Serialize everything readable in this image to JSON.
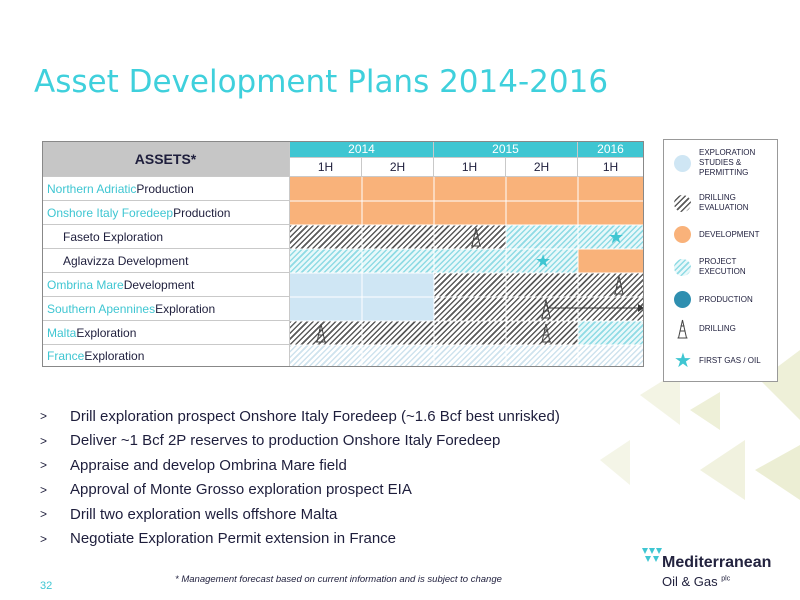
{
  "title": "Asset Development Plans 2014-2016",
  "colors": {
    "accent": "#3fc6d2",
    "development": "#f9b27a",
    "exploration_studies": "#cfe6f4",
    "production": "#2f8fb0",
    "header_gray": "#c6c6c6"
  },
  "table": {
    "assets_header": "ASSETS*",
    "years": [
      "2014",
      "2015",
      "2016"
    ],
    "halves": [
      "1H",
      "2H",
      "1H",
      "2H",
      "1H"
    ],
    "rows": [
      {
        "highlight": "Northern Adriatic",
        "rest": " Production",
        "sub": false
      },
      {
        "highlight": "Onshore Italy Foredeep",
        "rest": " Production",
        "sub": false
      },
      {
        "highlight": "",
        "rest": "Faseto Exploration",
        "sub": true
      },
      {
        "highlight": "",
        "rest": "Aglavizza Development",
        "sub": true
      },
      {
        "highlight": "Ombrina Mare",
        "rest": " Development",
        "sub": false
      },
      {
        "highlight": "Southern Apennines",
        "rest": " Exploration",
        "sub": false
      },
      {
        "highlight": "Malta",
        "rest": " Exploration",
        "sub": false
      },
      {
        "highlight": "France",
        "rest": " Exploration",
        "sub": false
      }
    ]
  },
  "legend": [
    {
      "label": "Exploration studies & permitting",
      "icon": "exploration-swatch"
    },
    {
      "label": "Drilling evaluation",
      "icon": "drilling-evaluation-swatch"
    },
    {
      "label": "Development",
      "icon": "development-swatch"
    },
    {
      "label": "Project execution",
      "icon": "project-execution-swatch"
    },
    {
      "label": "Production",
      "icon": "production-swatch"
    },
    {
      "label": "Drilling",
      "icon": "drilling-rig-icon"
    },
    {
      "label": "First gas / oil",
      "icon": "star-icon"
    }
  ],
  "bullets": [
    "Drill exploration prospect Onshore Italy Foredeep (~1.6 Bcf best unrisked)",
    "Deliver ~1 Bcf 2P reserves to production Onshore Italy Foredeep",
    "Appraise and develop Ombrina Mare field",
    "Approval of Monte Grosso exploration prospect EIA",
    "Drill two exploration wells offshore Malta",
    "Negotiate Exploration Permit extension in France"
  ],
  "bullet_marker": ">",
  "footnote": "* Management forecast based on current information and is subject to change",
  "page_number": "32",
  "logo": {
    "line1": "Mediterranean",
    "line2": "Oil & Gas",
    "suffix": "plc"
  }
}
